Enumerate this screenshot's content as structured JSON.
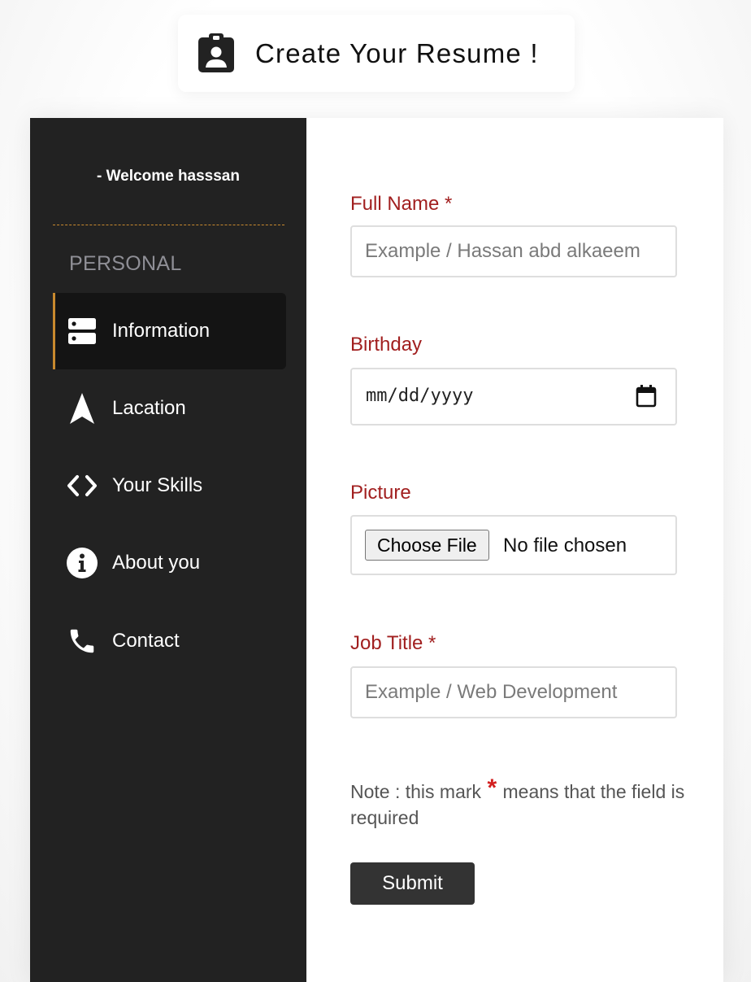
{
  "header": {
    "icon": "clipboard-user-icon",
    "title": "Create Your Resume !"
  },
  "sidebar": {
    "welcome": "- Welcome hasssan",
    "section_label": "PERSONAL",
    "accent_color": "#c8892e",
    "background_color": "#222222",
    "items": [
      {
        "label": "Information",
        "icon": "server-icon",
        "active": true
      },
      {
        "label": "Lacation",
        "icon": "navigation-arrow-icon",
        "active": false
      },
      {
        "label": "Your Skills",
        "icon": "code-icon",
        "active": false
      },
      {
        "label": "About you",
        "icon": "info-circle-icon",
        "active": false
      },
      {
        "label": "Contact",
        "icon": "phone-icon",
        "active": false
      }
    ]
  },
  "form": {
    "label_color": "#a11f1f",
    "full_name": {
      "label": "Full Name *",
      "placeholder": "Example / Hassan abd alkaeem",
      "value": ""
    },
    "birthday": {
      "label": "Birthday",
      "placeholder": "mm/dd/yyyy",
      "icon": "calendar-icon"
    },
    "picture": {
      "label": "Picture",
      "button_label": "Choose File",
      "status": "No file chosen"
    },
    "job_title": {
      "label": "Job Title *",
      "placeholder": "Example / Web Development",
      "value": ""
    },
    "note": {
      "prefix": "Note : this mark",
      "star": "*",
      "suffix": "means that the field is required"
    },
    "submit_label": "Submit"
  }
}
